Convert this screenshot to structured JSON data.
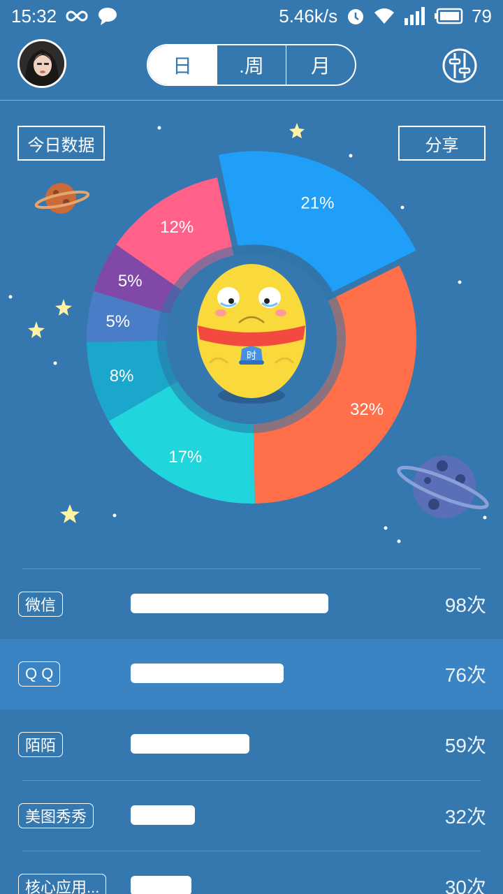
{
  "status_bar": {
    "time": "15:32",
    "network_speed": "5.46k/s",
    "battery": "79",
    "icons": [
      "infinity-icon",
      "chat-bubble-icon",
      "alarm-icon",
      "wifi-icon",
      "signal-icon",
      "battery-icon"
    ]
  },
  "header": {
    "tabs": [
      {
        "label": "日",
        "active": true
      },
      {
        "label": ".周",
        "active": false
      },
      {
        "label": "月",
        "active": false
      }
    ],
    "settings_icon": "settings-sliders-icon"
  },
  "buttons": {
    "today": "今日数据",
    "share": "分享"
  },
  "chart_data": {
    "type": "pie",
    "labels": [
      "21%",
      "32%",
      "17%",
      "8%",
      "5%",
      "5%",
      "12%"
    ],
    "values": [
      21,
      32,
      17,
      8,
      5,
      5,
      12
    ],
    "colors": [
      "#209ff8",
      "#ff6f4a",
      "#20d5dc",
      "#1ba6cb",
      "#4a7dc8",
      "#8049a7",
      "#ff6189"
    ],
    "donut": true,
    "highlighted_slice": 0
  },
  "mascot": {
    "badge": "时"
  },
  "usage_list": [
    {
      "name": "微信",
      "count": "98次",
      "value": 98
    },
    {
      "name": "Q Q",
      "count": "76次",
      "value": 76
    },
    {
      "name": "陌陌",
      "count": "59次",
      "value": 59
    },
    {
      "name": "美图秀秀",
      "count": "32次",
      "value": 32
    },
    {
      "name": "核心应用...",
      "count": "30次",
      "value": 30
    }
  ]
}
